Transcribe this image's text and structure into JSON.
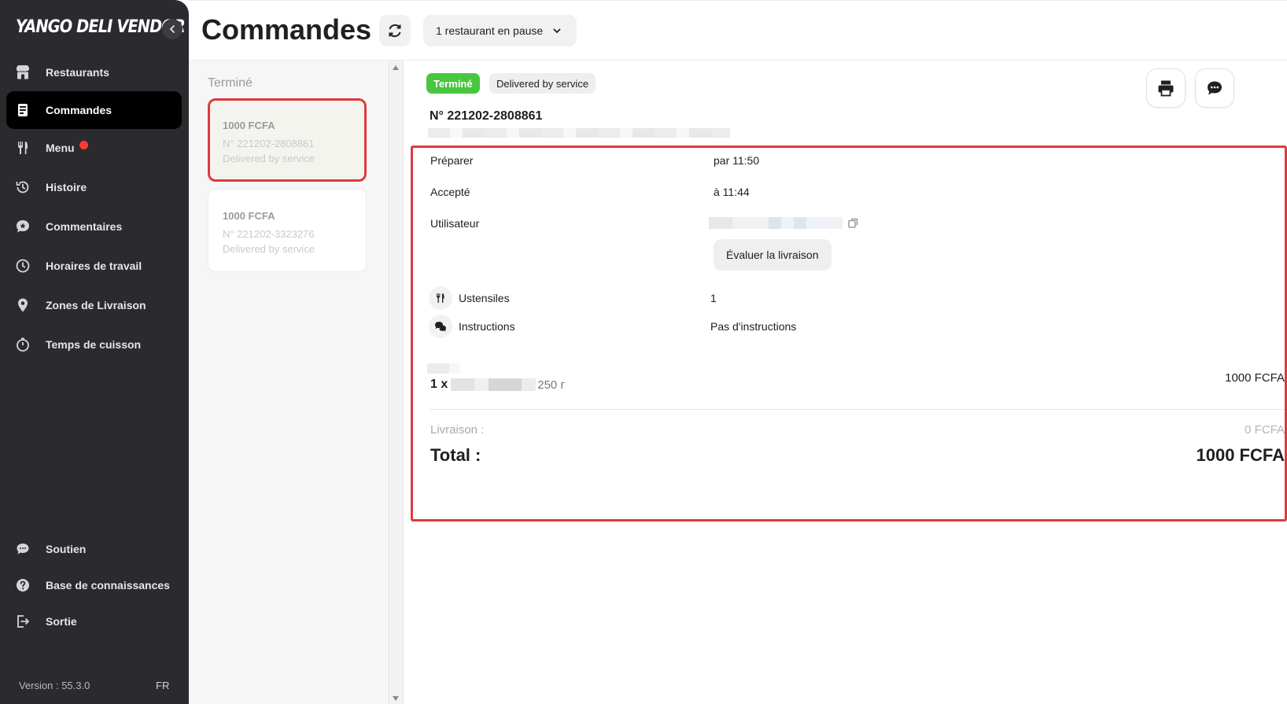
{
  "sidebar": {
    "logo": "YANGO DELI VENDOR",
    "items": [
      {
        "label": "Restaurants",
        "icon": "store-icon"
      },
      {
        "label": "Commandes",
        "icon": "orders-icon"
      },
      {
        "label": "Menu",
        "icon": "fork-knife-icon"
      },
      {
        "label": "Histoire",
        "icon": "history-icon"
      },
      {
        "label": "Commentaires",
        "icon": "star-comment-icon"
      },
      {
        "label": "Horaires de travail",
        "icon": "clock-icon"
      },
      {
        "label": "Zones de Livraison",
        "icon": "location-pin-icon"
      },
      {
        "label": "Temps de cuisson",
        "icon": "stopwatch-icon"
      }
    ],
    "bottom_items": [
      {
        "label": "Soutien",
        "icon": "chat-icon"
      },
      {
        "label": "Base de connaissances",
        "icon": "help-icon"
      },
      {
        "label": "Sortie",
        "icon": "logout-icon"
      }
    ],
    "version": "Version : 55.3.0",
    "language": "FR"
  },
  "header": {
    "title": "Commandes",
    "pause_select": "1 restaurant en pause"
  },
  "orders_list": {
    "heading": "Terminé",
    "cards": [
      {
        "price": "1000 FCFA",
        "number": "N° 221202-2808861",
        "status": "Delivered by service"
      },
      {
        "price": "1000 FCFA",
        "number": "N° 221202-3323276",
        "status": "Delivered by service"
      }
    ]
  },
  "detail": {
    "badge_status": "Terminé",
    "badge_delivery": "Delivered by service",
    "order_number": "N° 221202-2808861",
    "rows": {
      "prepare_label": "Préparer",
      "prepare_value": "par 11:50",
      "accepted_label": "Accepté",
      "accepted_value": "à 11:44",
      "user_label": "Utilisateur"
    },
    "rate_button": "Évaluer la livraison",
    "utensils_label": "Ustensiles",
    "utensils_value": "1",
    "instructions_label": "Instructions",
    "instructions_value": "Pas d'instructions",
    "item": {
      "qty": "1 x",
      "unit_price": "250 г",
      "total": "1000 FCFA"
    },
    "delivery_label": "Livraison :",
    "delivery_value": "0 FCFA",
    "total_label": "Total :",
    "total_value": "1000 FCFA"
  },
  "colors": {
    "sidebar_bg": "#2b2b2f",
    "done_badge": "#47c73f",
    "highlight_red": "#e0393e",
    "notification_dot": "#ff3b30"
  }
}
